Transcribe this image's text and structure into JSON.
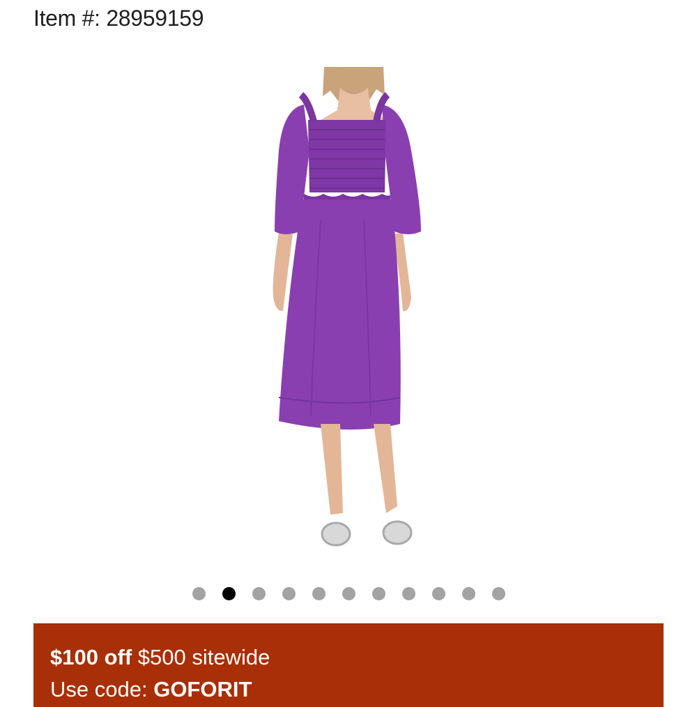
{
  "item": {
    "label": "Item #:",
    "number": "28959159"
  },
  "product": {
    "image_icon": "purple-midi-dress-photo",
    "dress_color": "#8a3fb0"
  },
  "carousel": {
    "count": 11,
    "active_index": 1
  },
  "promo": {
    "background": "#a82f07",
    "discount_amount": "$100 off",
    "discount_rest": "$500 sitewide",
    "code_label": "Use code:",
    "code": "GOFORIT"
  }
}
